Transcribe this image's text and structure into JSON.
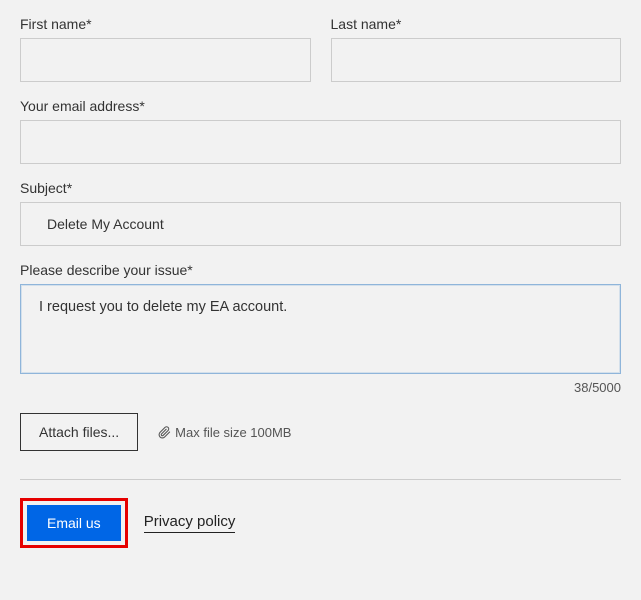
{
  "form": {
    "firstName": {
      "label": "First name*",
      "value": ""
    },
    "lastName": {
      "label": "Last name*",
      "value": ""
    },
    "email": {
      "label": "Your email address*",
      "value": ""
    },
    "subject": {
      "label": "Subject*",
      "value": "Delete My Account"
    },
    "issue": {
      "label": "Please describe your issue*",
      "value": "I request you to delete my EA account."
    },
    "counter": "38/5000",
    "attach": {
      "button": "Attach files...",
      "hint": "Max file size 100MB"
    },
    "submit": "Email us",
    "privacy": "Privacy policy"
  }
}
